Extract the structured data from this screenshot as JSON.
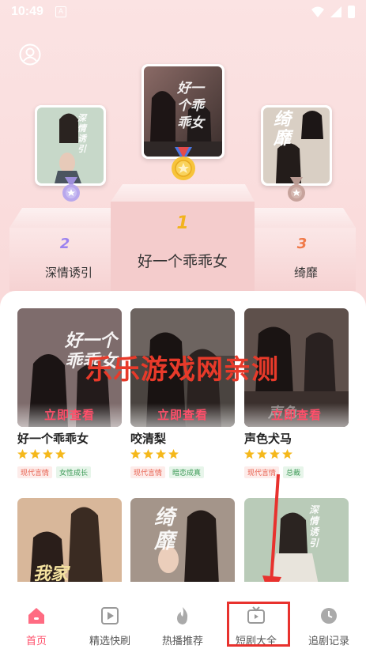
{
  "status_bar": {
    "time": "10:49",
    "notif_icon_letter": "A"
  },
  "colors": {
    "accent": "#ff4f6a",
    "nav_active": "#ff4f6a",
    "annotation_red": "#e8322e",
    "tag_red": "#e8604f",
    "tag_green": "#3d9a57",
    "star": "#f5b81b"
  },
  "podium": [
    {
      "rank": "1",
      "title": "好一个乖乖女",
      "poster_text": "好一个乖乖女",
      "medal": "gold-medal-icon"
    },
    {
      "rank": "2",
      "title": "深情诱引",
      "poster_text": "深情诱引",
      "medal": "silver-medal-icon"
    },
    {
      "rank": "3",
      "title": "绮靡",
      "poster_text": "绮靡",
      "medal": "bronze-medal-icon"
    }
  ],
  "watch_label": "立即查看",
  "watermark": "乐乐游戏网亲测",
  "dramas": [
    {
      "title": "好一个乖乖女",
      "stars": 4,
      "tags": [
        "现代言情",
        "女性成长"
      ],
      "poster_text": "好一个乖乖女"
    },
    {
      "title": "咬清梨",
      "stars": 4,
      "tags": [
        "现代言情",
        "暗恋成真"
      ],
      "poster_text": "咬清梨"
    },
    {
      "title": "声色犬马",
      "stars": 4,
      "tags": [
        "现代言情",
        "总裁"
      ],
      "poster_text": "声色"
    },
    {
      "title": "",
      "stars": 0,
      "tags": [],
      "poster_text": "我家"
    },
    {
      "title": "",
      "stars": 0,
      "tags": [],
      "poster_text": "绮靡"
    },
    {
      "title": "",
      "stars": 0,
      "tags": [],
      "poster_text": "深情诱引"
    }
  ],
  "bottom_nav": [
    {
      "label": "首页",
      "icon": "home-icon",
      "active": true
    },
    {
      "label": "精选快刷",
      "icon": "play-icon",
      "active": false
    },
    {
      "label": "热播推荐",
      "icon": "flame-icon",
      "active": false
    },
    {
      "label": "短剧大全",
      "icon": "tv-icon",
      "active": false
    },
    {
      "label": "追剧记录",
      "icon": "clock-icon",
      "active": false
    }
  ]
}
